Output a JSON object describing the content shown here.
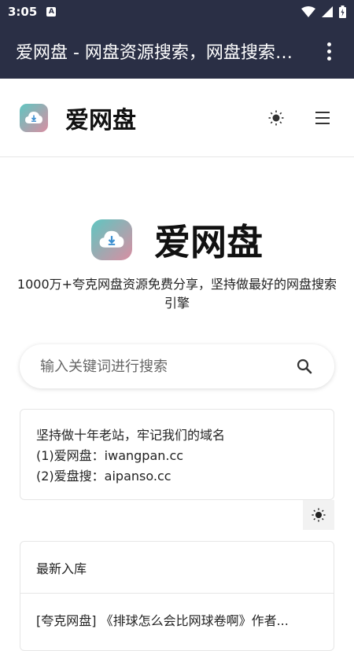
{
  "status_bar": {
    "time": "3:05",
    "badge": "A"
  },
  "app_bar": {
    "title": "爱网盘 - 网盘资源搜索，网盘搜索引擎"
  },
  "header": {
    "brand": "爱网盘"
  },
  "hero": {
    "title": "爱网盘",
    "tagline": "1000万+夸克网盘资源免费分享，坚持做最好的网盘搜索引擎"
  },
  "search": {
    "placeholder": "输入关键词进行搜索"
  },
  "notice": {
    "lines": [
      "坚持做十年老站，牢记我们的域名",
      "(1)爱网盘：iwangpan.cc",
      "(2)爱盘搜：aipanso.cc"
    ]
  },
  "latest": {
    "header": "最新入库",
    "items": [
      "[夸克网盘] 《排球怎么会比网球卷啊》作者..."
    ]
  },
  "colors": {
    "appbar": "#2a2f45",
    "logo_start": "#5fc6c1",
    "logo_end": "#d98ea2"
  }
}
